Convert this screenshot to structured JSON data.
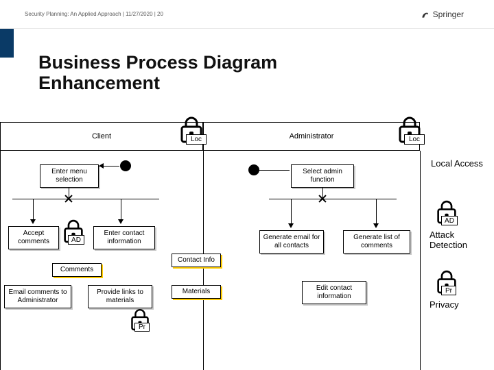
{
  "header": {
    "breadcrumb": "Security Planning: An Applied Approach | 11/27/2020 | 20",
    "publisher": "Springer"
  },
  "title_line1": "Business Process Diagram",
  "title_line2": "Enhancement",
  "lanes": {
    "client": "Client",
    "admin": "Administrator"
  },
  "lockText": "Loc",
  "tasks": {
    "enterMenu": "Enter menu selection",
    "acceptComments": "Accept comments",
    "enterContact": "Enter contact information",
    "emailAdmin": "Email comments to Administrator",
    "provideLinks": "Provide links to materials",
    "selectAdmin": "Select admin function",
    "generateEmail": "Generate email for all contacts",
    "generateList": "Generate list of comments",
    "editContact": "Edit contact information"
  },
  "dataObjects": {
    "comments": "Comments",
    "contactInfo": "Contact Info",
    "materials": "Materials"
  },
  "lockTags": {
    "ad": "AD",
    "pr": "Pr"
  },
  "legend": {
    "localAccess": "Local Access",
    "attackDetection": "Attack Detection",
    "privacy": "Privacy"
  }
}
